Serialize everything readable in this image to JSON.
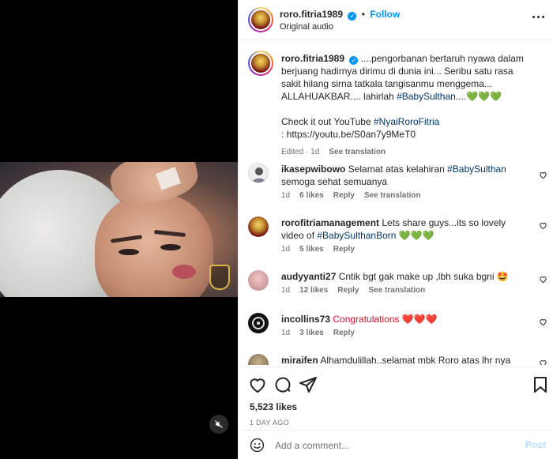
{
  "post": {
    "username": "roro.fitria1989",
    "verified_badge": "✓",
    "follow_label": "Follow",
    "audio_label": "Original audio",
    "separator": "•"
  },
  "caption": {
    "username": "roro.fitria1989",
    "text": "....pengorbanan bertaruh nyawa dalam berjuang hadirnya dirimu di dunia ini... Seribu satu rasa sakit hilang sirna tatkala tangisanmu menggema... ALLAHUAKBAR.... lahirlah ",
    "hashtag": "#BabySulthan",
    "text_end": "....",
    "hearts": "💚💚💚",
    "line2_prefix": "Check it out YouTube ",
    "line2_hashtag": "#NyaiRoroFitria",
    "line3": ": https://youtu.be/S0an7y9MeT0",
    "edited": "Edited",
    "time": "1d",
    "see_translation": "See translation"
  },
  "comments": [
    {
      "user": "ikasepwibowo",
      "text_before": "Selamat atas kelahiran ",
      "hashtag": "#BabySulthan",
      "text_after": " semoga sehat semuanya",
      "time": "1d",
      "likes": "6 likes",
      "reply": "Reply",
      "translate": "See translation"
    },
    {
      "user": "rorofitriamanagement",
      "text_before": "Lets share guys...its so lovely video of ",
      "hashtag": "#BabySulthanBorn",
      "text_after": " 💚💚💚",
      "time": "1d",
      "likes": "5 likes",
      "reply": "Reply",
      "translate": ""
    },
    {
      "user": "audyyanti27",
      "text_before": "Cntik bgt gak make up ,lbh suka bgni 🤩",
      "hashtag": "",
      "text_after": "",
      "time": "1d",
      "likes": "12 likes",
      "reply": "Reply",
      "translate": "See translation"
    },
    {
      "user": "incollins73",
      "text_before": "Congratulations ❤️❤️❤️",
      "hashtag": "",
      "text_after": "",
      "time": "1d",
      "likes": "3 likes",
      "reply": "Reply",
      "translate": ""
    },
    {
      "user": "miraifen",
      "text_before": "Alhamdulillah..selamat mbk Roro atas lhr nya putra",
      "hashtag": "",
      "text_after": "",
      "time": "",
      "likes": "",
      "reply": "",
      "translate": ""
    }
  ],
  "footer": {
    "likes": "5,523 likes",
    "date": "1 DAY AGO",
    "comment_placeholder": "Add a comment...",
    "post_label": "Post"
  },
  "colors": {
    "accent": "#0095f6",
    "hashtag": "#00376b",
    "muted": "#737373"
  }
}
